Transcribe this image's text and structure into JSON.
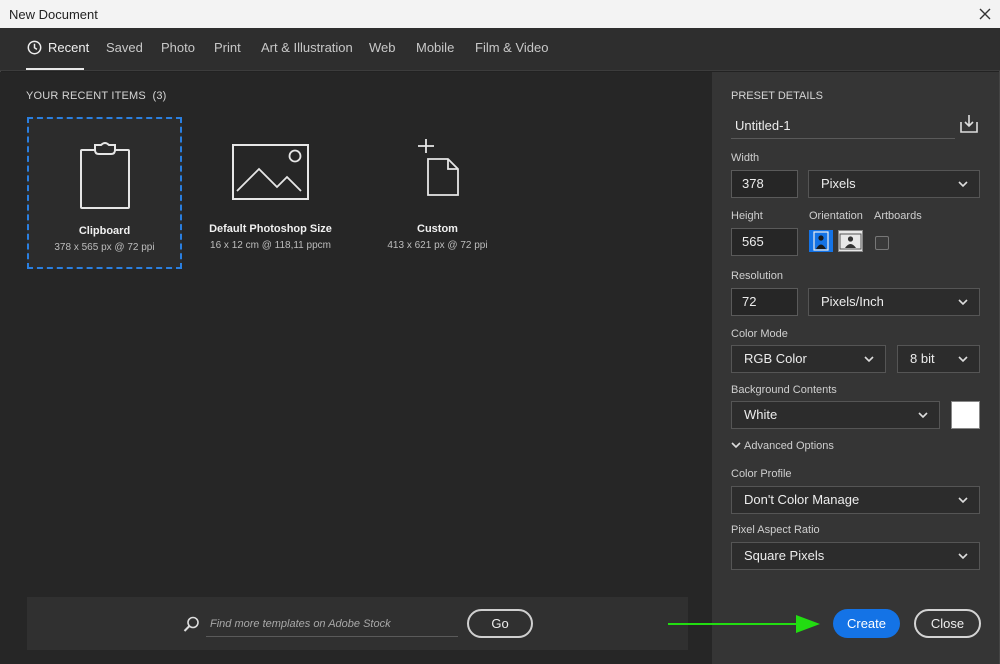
{
  "window": {
    "title": "New Document"
  },
  "tabs": [
    {
      "label": "Recent"
    },
    {
      "label": "Saved"
    },
    {
      "label": "Photo"
    },
    {
      "label": "Print"
    },
    {
      "label": "Art & Illustration"
    },
    {
      "label": "Web"
    },
    {
      "label": "Mobile"
    },
    {
      "label": "Film & Video"
    }
  ],
  "recent": {
    "title": "YOUR RECENT ITEMS",
    "count": "(3)",
    "items": [
      {
        "name": "Clipboard",
        "details": "378 x 565 px @ 72 ppi",
        "icon": "clipboard-icon"
      },
      {
        "name": "Default Photoshop Size",
        "details": "16 x 12 cm @ 118,11 ppcm",
        "icon": "image-icon"
      },
      {
        "name": "Custom",
        "details": "413 x 621 px @ 72 ppi",
        "icon": "custom-document-icon"
      }
    ]
  },
  "stock": {
    "placeholder": "Find more templates on Adobe Stock",
    "go_label": "Go"
  },
  "preset": {
    "title": "PRESET DETAILS",
    "name": "Untitled-1",
    "width_label": "Width",
    "width_value": "378",
    "width_unit": "Pixels",
    "height_label": "Height",
    "height_value": "565",
    "orientation_label": "Orientation",
    "artboards_label": "Artboards",
    "resolution_label": "Resolution",
    "resolution_value": "72",
    "resolution_unit": "Pixels/Inch",
    "color_mode_label": "Color Mode",
    "color_mode": "RGB Color",
    "bit_depth": "8 bit",
    "background_label": "Background Contents",
    "background": "White",
    "background_swatch": "#ffffff",
    "advanced_label": "Advanced Options",
    "color_profile_label": "Color Profile",
    "color_profile": "Don't Color Manage",
    "pixel_aspect_label": "Pixel Aspect Ratio",
    "pixel_aspect": "Square Pixels"
  },
  "buttons": {
    "create": "Create",
    "close": "Close"
  },
  "colors": {
    "accent": "#1473e6",
    "selection": "#2a7fe0",
    "annotation_arrow": "#22dd11"
  }
}
